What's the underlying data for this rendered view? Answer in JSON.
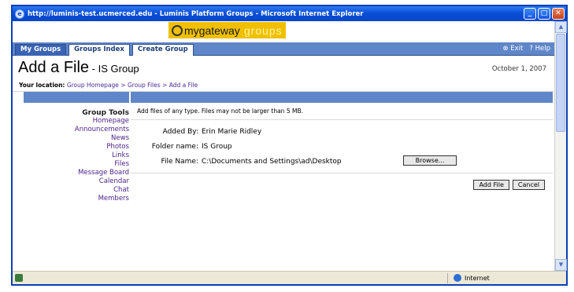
{
  "window": {
    "title": "http://luminis-test.ucmerced.edu - Luminis Platform Groups - Microsoft Internet Explorer",
    "minimize_glyph": "_",
    "maximize_glyph": "□",
    "close_glyph": "✕"
  },
  "banner": {
    "logo_text": "mygateway",
    "logo_suffix": "groups"
  },
  "tabs": [
    {
      "label": "My Groups",
      "active": true
    },
    {
      "label": "Groups Index",
      "active": false
    },
    {
      "label": "Create Group",
      "active": false
    }
  ],
  "top_links": {
    "exit": "Exit",
    "help": "Help"
  },
  "page": {
    "title": "Add a File",
    "title_sep": " - ",
    "group_name": "IS Group",
    "date": "October 1, 2007",
    "location_label": "Your location:",
    "breadcrumb": "Group Homepage > Group Files > Add a File"
  },
  "sidebar": {
    "title": "Group Tools",
    "items": [
      "Homepage",
      "Announcements",
      "News",
      "Photos",
      "Links",
      "Files",
      "Message Board",
      "Calendar",
      "Chat",
      "Members"
    ]
  },
  "form": {
    "instructions": "Add files of any type. Files may not be larger than 5 MB.",
    "added_by_label": "Added By:",
    "added_by_value": "Erin Marie Ridley",
    "folder_label": "Folder name:",
    "folder_value": "IS Group",
    "file_label": "File Name:",
    "file_value": "C:\\Documents and Settings\\ad\\Desktop",
    "browse_label": "Browse...",
    "add_button": "Add File",
    "cancel_button": "Cancel"
  },
  "status": {
    "left_text": "",
    "zone_text": "Internet"
  }
}
